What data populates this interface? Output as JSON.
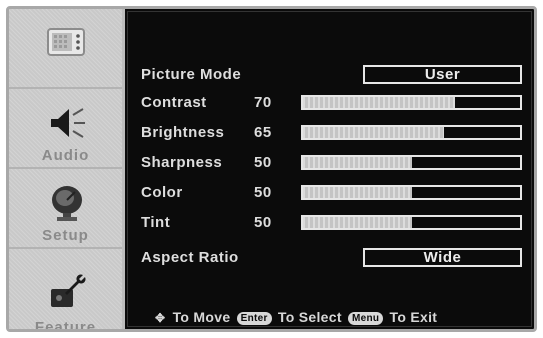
{
  "sidebar": {
    "items": [
      {
        "label": "",
        "icon": "picture-menu-icon"
      },
      {
        "label": "Audio",
        "icon": "speaker-icon"
      },
      {
        "label": "Setup",
        "icon": "satellite-dish-icon"
      },
      {
        "label": "Feature",
        "icon": "wrench-icon"
      }
    ]
  },
  "picture": {
    "mode": {
      "label": "Picture Mode",
      "value": "User"
    },
    "contrast": {
      "label": "Contrast",
      "value": "70",
      "level": 70
    },
    "brightness": {
      "label": "Brightness",
      "value": "65",
      "level": 65
    },
    "sharpness": {
      "label": "Sharpness",
      "value": "50",
      "level": 50
    },
    "color": {
      "label": "Color",
      "value": "50",
      "level": 50
    },
    "tint": {
      "label": "Tint",
      "value": "50",
      "level": 50
    },
    "aspect": {
      "label": "Aspect Ratio",
      "value": "Wide"
    }
  },
  "footer": {
    "move_text": "To Move",
    "enter_key": "Enter",
    "select_text": "To Select",
    "menu_key": "Menu",
    "exit_text": "To Exit",
    "move_icon": "arrows-icon"
  },
  "colors": {
    "panel_bg": "#0b0b0b",
    "sidebar_bg": "#c9c9c9",
    "text": "#dedede"
  }
}
